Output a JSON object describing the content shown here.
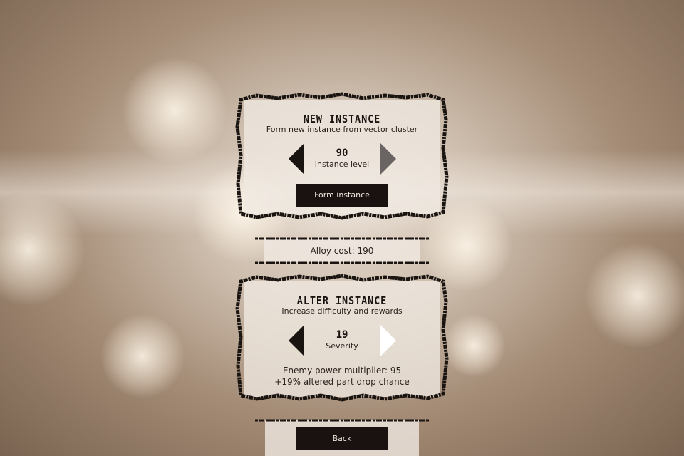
{
  "new_instance": {
    "title": "NEW INSTANCE",
    "subtitle": "Form new instance from vector cluster",
    "level_value": "90",
    "level_label": "Instance level",
    "form_button": "Form instance"
  },
  "cost": {
    "text": "Alloy cost: 190"
  },
  "alter_instance": {
    "title": "ALTER INSTANCE",
    "subtitle": "Increase difficulty and rewards",
    "severity_value": "19",
    "severity_label": "Severity",
    "multiplier_text": "Enemy power multiplier: 95",
    "drop_text": "+19% altered part drop chance"
  },
  "back": {
    "label": "Back"
  },
  "colors": {
    "ink": "#1a1411",
    "arrow_disabled": "#6a6562",
    "arrow_active": "#ffffff",
    "button_bg": "#1a1210"
  },
  "icons": {
    "prev": "triangle-left-icon",
    "next": "triangle-right-icon"
  }
}
